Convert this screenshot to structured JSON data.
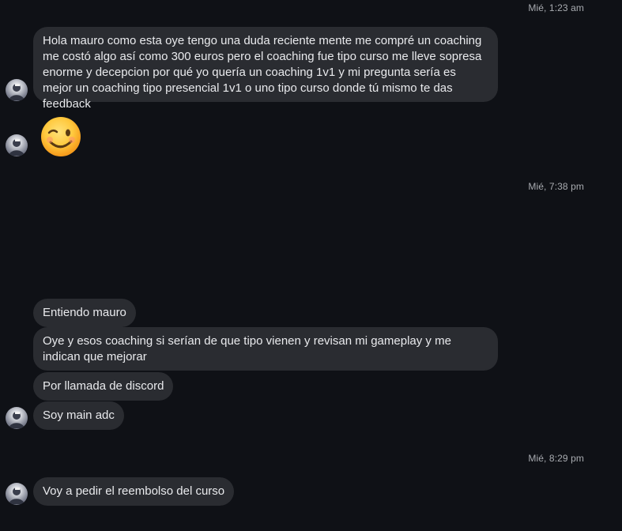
{
  "timestamps": {
    "t1": "Mié, 1:23 am",
    "t2": "Mié, 7:38 pm",
    "t3": "Mié, 8:29 pm"
  },
  "messages": [
    {
      "text": "Hola mauro como esta oye tengo una duda reciente mente me compré un coaching me costó algo así como 300 euros pero el coaching fue tipo curso me lleve sopresa enorme y decepcion por qué yo quería un coaching 1v1 y mi pregunta sería es mejor un coaching tipo presencial 1v1 o uno tipo curso donde tú mismo te das feedback"
    },
    {
      "text": "Entiendo mauro"
    },
    {
      "text": "Oye y esos coaching si serían de que tipo vienen y revisan mi gameplay y me indican que mejorar"
    },
    {
      "text": "Por llamada de discord"
    },
    {
      "text": "Soy main adc"
    },
    {
      "text": "Voy a pedir el reembolso del curso"
    }
  ],
  "emoji": {
    "icon": "winking-face-emoji"
  },
  "colors": {
    "background": "#0f1116",
    "bubble": "#2a2c31",
    "text": "#e9eaed",
    "timestamp": "#a8abb0"
  }
}
